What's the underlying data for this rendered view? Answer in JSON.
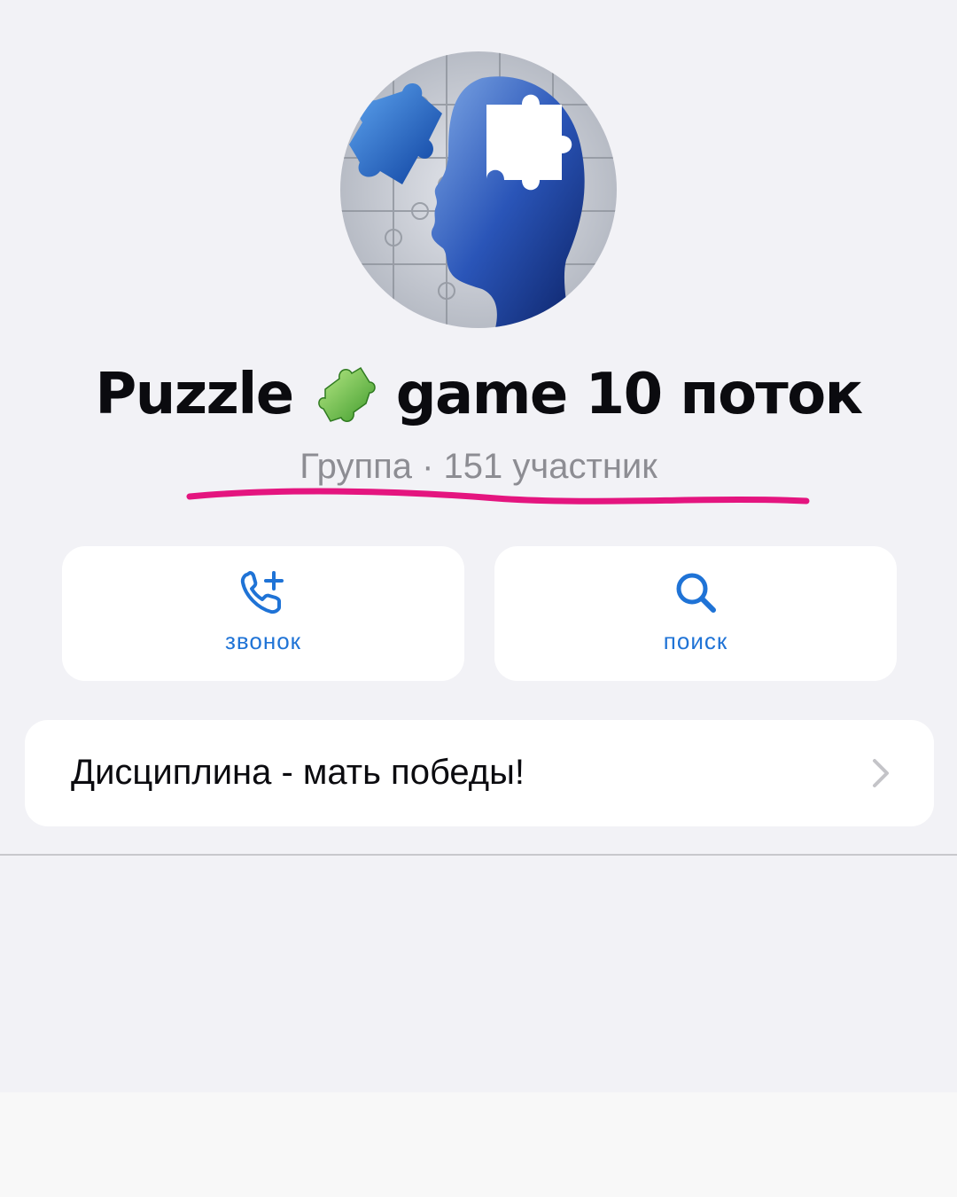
{
  "profile": {
    "avatar_icon": "puzzle-head-avatar",
    "title_part1": "Puzzle",
    "title_emoji_icon": "puzzle-piece-icon",
    "title_part2": "game 10 поток",
    "subtitle": "Группа · 151 участник",
    "underline_color": "#e4157f"
  },
  "actions": {
    "call": {
      "label": "звонок",
      "icon": "phone-add-icon"
    },
    "search": {
      "label": "поиск",
      "icon": "search-icon"
    }
  },
  "description": {
    "text": "Дисциплина - мать победы!",
    "icon": "chevron-right-icon"
  },
  "colors": {
    "accent": "#1f73d6",
    "background": "#f2f2f6",
    "card": "#ffffff",
    "secondary_text": "#8d8d93"
  }
}
